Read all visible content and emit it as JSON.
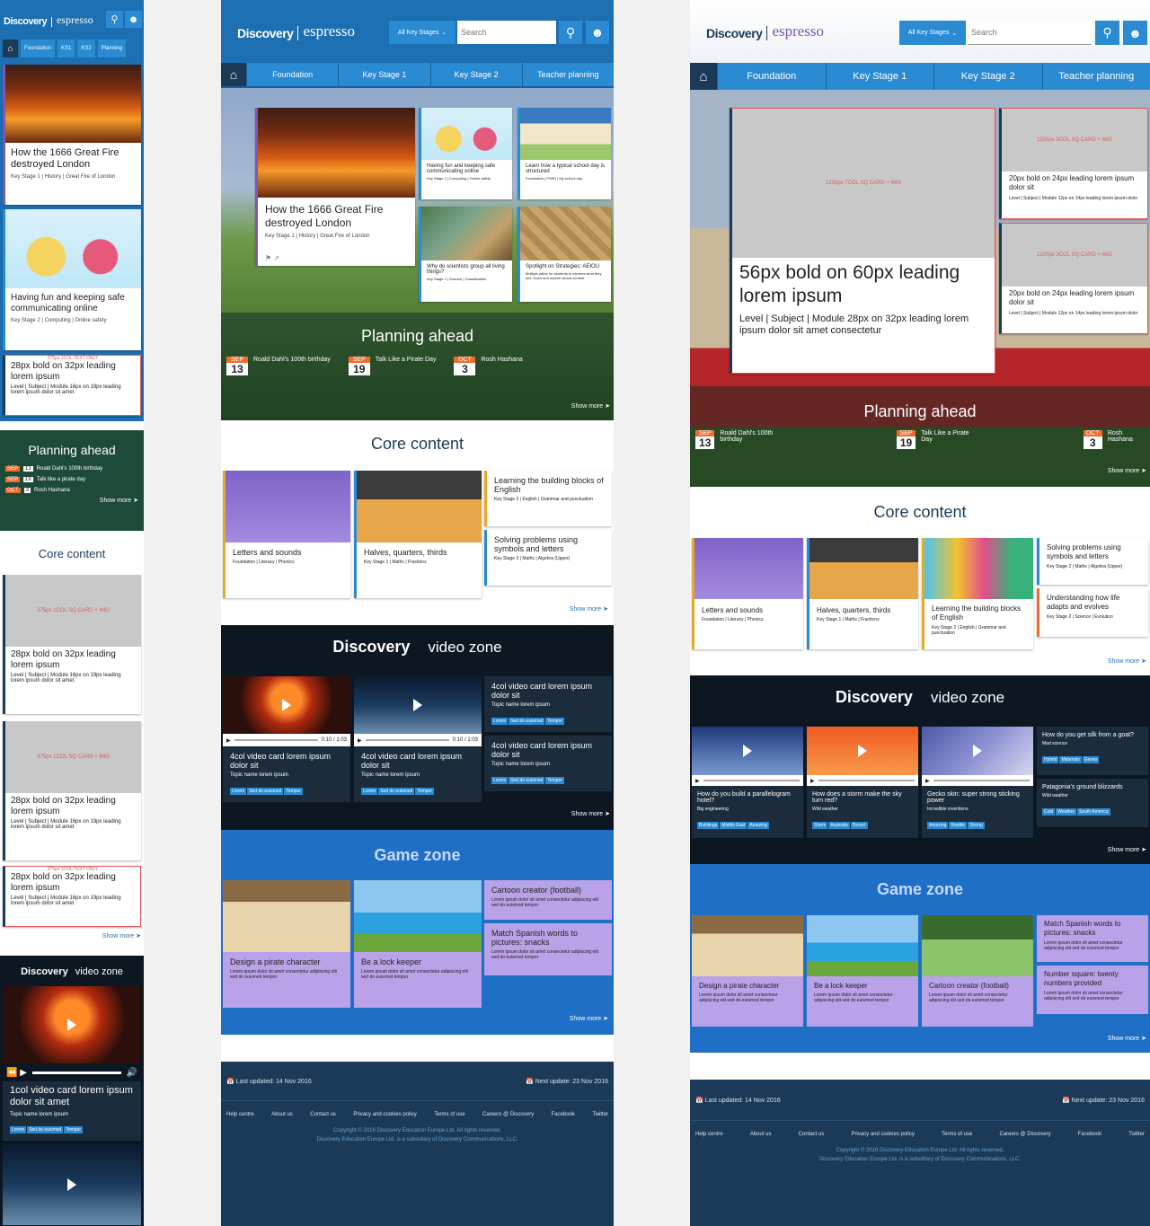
{
  "brand": {
    "discovery": "Discovery",
    "education": "EDUCATION",
    "espresso": "espresso"
  },
  "search": {
    "placeholder": "Search",
    "keystage": "All Key Stages"
  },
  "nav_mobile": [
    "Foundation",
    "KS1",
    "KS2",
    "Planning"
  ],
  "nav_full": [
    "Foundation",
    "Key Stage 1",
    "Key Stage 2",
    "Teacher planning"
  ],
  "hero": {
    "title": "How the 1666 Great Fire destroyed London",
    "meta": "Key Stage 1  |  History  |  Great Fire of London"
  },
  "mobile_cards": [
    {
      "title": "Having fun and keeping safe communicating online",
      "meta": "Key Stage 2  |  Computing  |  Online safety"
    }
  ],
  "tablet_small": [
    {
      "title": "Having fun and keeping safe communicating online",
      "meta": "Key Stage 2 | Computing | Online safety"
    },
    {
      "title": "Learn how a typical school day is structured",
      "meta": "Foundation | PSED | My school day"
    },
    {
      "title": "Why do scientists group all living things?",
      "meta": "Key Stage 2 | Science | Classification"
    },
    {
      "title": "Spotlight on Strategies: AEIOU",
      "meta": "Multiple paths for students to express what they see, know and wonder about content"
    }
  ],
  "placeholder": {
    "col1_text": "375px 1COL TEXT ONLY",
    "col1_card": "375px 1COL SQ CARD + IMG",
    "col7": "1200px 7COL SQ CARD + IMG",
    "col3": "1200px 3COL SQ CARD + IMG",
    "h28": "28px bold on 32px leading lorem ipsum",
    "m16": "Level  |  Subject  |  Module 16px on 19px leading lorem ipsum dolor sit amet",
    "h56": "56px bold on 60px leading lorem ipsum",
    "m28": "Level  |  Subject  |  Module 28px on 32px leading lorem ipsum dolor sit amet consectetur",
    "h20": "20px bold on 24px leading lorem ipsum dolor sit",
    "m12": "Level  |  Subject  |  Module 12px on 14px leading lorem ipsum dolor"
  },
  "planning": {
    "title": "Planning ahead",
    "events": [
      {
        "month": "SEP",
        "day": "13",
        "label": "Roald Dahl's 100th birthday"
      },
      {
        "month": "SEP",
        "day": "19",
        "label": "Talk Like a Pirate Day"
      },
      {
        "month": "OCT",
        "day": "3",
        "label": "Rosh Hashana"
      }
    ],
    "mobile_events": [
      {
        "label": "Roald Dahl's 100th birthday"
      },
      {
        "label": "Talk like a pirate day"
      },
      {
        "label": "Rosh Hashana"
      }
    ]
  },
  "show_more": "Show more",
  "core": {
    "title": "Core content",
    "tablet": [
      {
        "title": "Letters and sounds",
        "meta": "Foundation  |  Literacy  |  Phonics"
      },
      {
        "title": "Halves, quarters, thirds",
        "meta": "Key Stage 1  |  Maths  |  Fractions"
      },
      {
        "title": "Learning the building blocks of English",
        "meta": "Key Stage 2  |  English  |  Grammar and punctuation"
      },
      {
        "title": "Solving problems using symbols and letters",
        "meta": "Key Stage 2  |  Maths  |  Algebra (Upper)"
      }
    ],
    "desktop": [
      {
        "title": "Letters and sounds",
        "meta": "Foundation | Literacy | Phonics"
      },
      {
        "title": "Halves, quarters, thirds",
        "meta": "Key Stage 1 | Maths | Fractions"
      },
      {
        "title": "Learning the building blocks of English",
        "meta": "Key Stage 2 | English | Grammar and punctuation"
      },
      {
        "title": "Solving problems using symbols and letters",
        "meta": "Key Stage 2 | Maths | Algebra (Upper)"
      },
      {
        "title": "Understanding how life adapts and evolves",
        "meta": "Key Stage 2 | Science | Evolution"
      }
    ]
  },
  "video": {
    "zone": "video zone",
    "time": "0:10 / 1:03",
    "tablet": [
      {
        "title": "4col video card lorem ipsum dolor sit",
        "topic": "Topic name lorem ipsum",
        "tags": [
          "Lorem",
          "Sed do euismod",
          "Tempor"
        ]
      }
    ],
    "mobile": {
      "title": "1col video card lorem ipsum dolor sit amet",
      "topic": "Topic name lorem ipsum",
      "tags": [
        "Lorem",
        "Sed do euismod",
        "Tempor"
      ]
    },
    "desktop": [
      {
        "title": "How do you build a parallelogram hotel?",
        "topic": "Big engineering",
        "tags": [
          "Buildings",
          "Middle East",
          "Amazing"
        ]
      },
      {
        "title": "How does a storm make the sky turn red?",
        "topic": "Wild weather",
        "tags": [
          "Storm",
          "Australia",
          "Desert"
        ]
      },
      {
        "title": "Gecko skin: super strong sticking power",
        "topic": "Incredible inventions",
        "tags": [
          "Amazing",
          "Reptile",
          "Strong"
        ]
      },
      {
        "title": "How do you get silk from a goat?",
        "topic": "Mad science",
        "tags": [
          "Hybrid",
          "Materials",
          "Genes"
        ]
      },
      {
        "title": "Patagonia's ground blizzards",
        "topic": "Wild weather",
        "tags": [
          "Cold",
          "Weather",
          "South America"
        ]
      }
    ]
  },
  "game": {
    "zone": "Game zone",
    "desc": "Lorem ipsum dolor sit amet consectetur adipiscing elit sed do euismod tempor",
    "tablet": [
      "Design a pirate character",
      "Be a lock keeper",
      "Cartoon creator (football)",
      "Match Spanish words to pictures: snacks"
    ],
    "desktop": [
      "Design a pirate character",
      "Be a lock keeper",
      "Cartoon creator (football)",
      "Match Spanish words to pictures: snacks",
      "Number square: twenty numbers provided"
    ]
  },
  "footer": {
    "last": "Last updated: 14 Nov 2016",
    "next": "Next update: 23 Nov 2016",
    "links": [
      "Help centre",
      "About us",
      "Contact us",
      "Privacy and cookies policy",
      "Terms of use",
      "Careers @ Discovery",
      "Facebook",
      "Twitter"
    ],
    "copy1": "Copyright © 2016 Discovery Education Europe Ltd. All rights reserved.",
    "copy2": "Discovery Education Europe Ltd. is a subsidiary of Discovery Communications, LLC."
  }
}
